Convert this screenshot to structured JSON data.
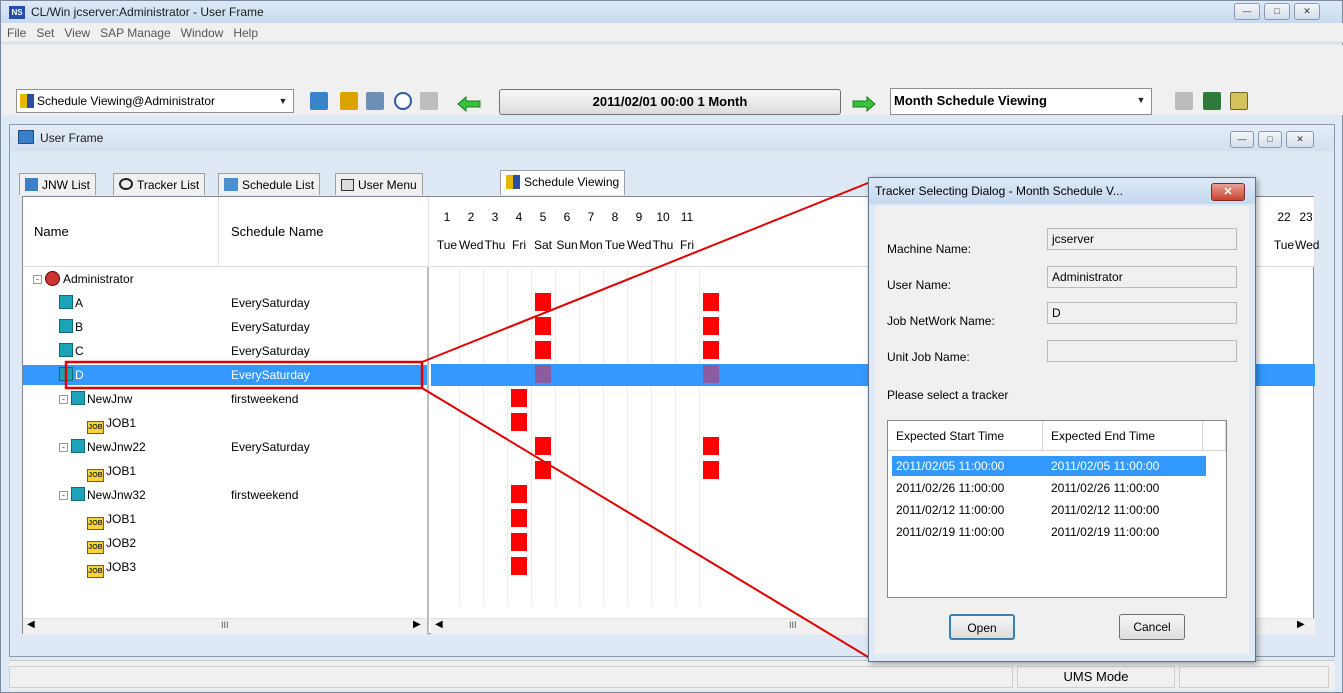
{
  "window": {
    "title": "CL/Win jcserver:Administrator - User Frame",
    "logo_text": "NS"
  },
  "menu": [
    "File",
    "Set",
    "View",
    "SAP Manage",
    "Window",
    "Help"
  ],
  "toolbar": {
    "view_combo": "Schedule Viewing@Administrator",
    "date_range": "2011/02/01 00:00   1 Month",
    "mode_combo": "Month Schedule Viewing"
  },
  "frame": {
    "title": "User Frame",
    "tabs": [
      "JNW List",
      "Tracker List",
      "Schedule List",
      "User Menu",
      "Schedule Viewing"
    ],
    "active_tab": 4
  },
  "table": {
    "col_name": "Name",
    "col_schedule": "Schedule Name",
    "scroll_glyph": "III"
  },
  "tree": [
    {
      "name": "Administrator",
      "schedule": "",
      "type": "user",
      "level": 0
    },
    {
      "name": "A",
      "schedule": "EverySaturday",
      "type": "jnw",
      "level": 1
    },
    {
      "name": "B",
      "schedule": "EverySaturday",
      "type": "jnw",
      "level": 1
    },
    {
      "name": "C",
      "schedule": "EverySaturday",
      "type": "jnw",
      "level": 1
    },
    {
      "name": "D",
      "schedule": "EverySaturday",
      "type": "jnw",
      "level": 1
    },
    {
      "name": "NewJnw",
      "schedule": "firstweekend",
      "type": "jnw",
      "level": 1
    },
    {
      "name": "JOB1",
      "schedule": "",
      "type": "job",
      "level": 2
    },
    {
      "name": "NewJnw22",
      "schedule": "EverySaturday",
      "type": "jnw",
      "level": 1
    },
    {
      "name": "JOB1",
      "schedule": "",
      "type": "job",
      "level": 2
    },
    {
      "name": "NewJnw32",
      "schedule": "firstweekend",
      "type": "jnw",
      "level": 1
    },
    {
      "name": "JOB1",
      "schedule": "",
      "type": "job",
      "level": 2
    },
    {
      "name": "JOB2",
      "schedule": "",
      "type": "job",
      "level": 2
    },
    {
      "name": "JOB3",
      "schedule": "",
      "type": "job",
      "level": 2
    }
  ],
  "calendar": {
    "days": [
      "1",
      "2",
      "3",
      "4",
      "5",
      "6",
      "7",
      "8",
      "9",
      "10",
      "11"
    ],
    "day_names": [
      "Tue",
      "Wed",
      "Thu",
      "Fri",
      "Sat",
      "Sun",
      "Mon",
      "Tue",
      "Wed",
      "Thu",
      "Fri"
    ],
    "right_days": [
      "22",
      "23"
    ],
    "right_day_names": [
      "Tue",
      "Wed"
    ],
    "selected_row": 4,
    "marks": [
      {
        "row": 1,
        "day": 5
      },
      {
        "row": 2,
        "day": 5
      },
      {
        "row": 3,
        "day": 5
      },
      {
        "row": 4,
        "day": 5
      },
      {
        "row": 5,
        "day": 4
      },
      {
        "row": 6,
        "day": 4
      },
      {
        "row": 7,
        "day": 5
      },
      {
        "row": 8,
        "day": 5
      },
      {
        "row": 9,
        "day": 4
      },
      {
        "row": 10,
        "day": 4
      },
      {
        "row": 11,
        "day": 4
      },
      {
        "row": 12,
        "day": 4
      },
      {
        "row": 1,
        "day": 12
      },
      {
        "row": 2,
        "day": 12
      },
      {
        "row": 3,
        "day": 12
      },
      {
        "row": 4,
        "day": 12
      },
      {
        "row": 7,
        "day": 12
      },
      {
        "row": 8,
        "day": 12
      }
    ]
  },
  "status": {
    "mode": "UMS Mode"
  },
  "dialog": {
    "title": "Tracker Selecting Dialog - Month Schedule V...",
    "machine_label": "Machine Name:",
    "machine_value": "jcserver",
    "user_label": "User Name:",
    "user_value": "Administrator",
    "jnw_label": "Job NetWork Name:",
    "jnw_value": "D",
    "unit_label": "Unit Job Name:",
    "unit_value": "",
    "prompt": "Please select a tracker",
    "col_start": "Expected Start Time",
    "col_end": "Expected End Time",
    "rows": [
      {
        "start": "2011/02/05 11:00:00",
        "end": "2011/02/05 11:00:00",
        "selected": true
      },
      {
        "start": "2011/02/26 11:00:00",
        "end": "2011/02/26 11:00:00",
        "selected": false
      },
      {
        "start": "2011/02/12 11:00:00",
        "end": "2011/02/12 11:00:00",
        "selected": false
      },
      {
        "start": "2011/02/19 11:00:00",
        "end": "2011/02/19 11:00:00",
        "selected": false
      }
    ],
    "open_label": "Open",
    "cancel_label": "Cancel",
    "close_glyph": "✕"
  },
  "colors": {
    "selection": "#3399ff",
    "mark": "#ff0000",
    "mark_selected": "#8f5aa0",
    "callout": "#e00000"
  }
}
